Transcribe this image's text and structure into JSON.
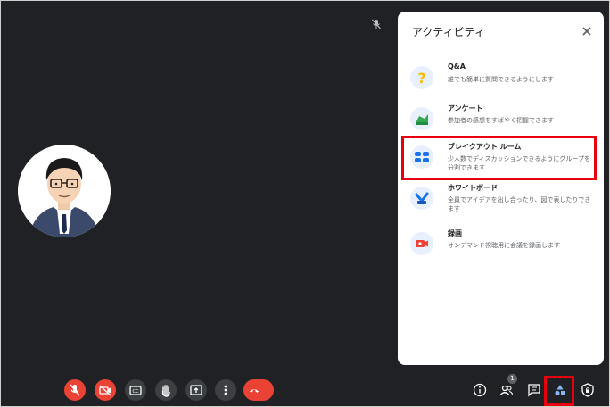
{
  "activities_panel": {
    "title": "アクティビティ",
    "close_icon": "close-icon",
    "items": [
      {
        "name": "Q&A",
        "description": "誰でも簡単に質問できるようにします",
        "icon": "question-icon"
      },
      {
        "name": "アンケート",
        "description": "参加者の感想をすばやく把握できます",
        "icon": "poll-icon"
      },
      {
        "name": "ブレイクアウト ルーム",
        "description": "少人数でディスカッションできるようにグループを分割できます",
        "icon": "breakout-rooms-icon",
        "highlighted": true
      },
      {
        "name": "ホワイトボード",
        "description": "全員でアイデアを出し合ったり、図で表したりできます",
        "icon": "whiteboard-icon"
      },
      {
        "name": "録画",
        "description": "オンデマンド視聴用に会議を録画します",
        "icon": "record-icon"
      }
    ]
  },
  "participant_avatar": {
    "icon": "user-avatar"
  },
  "mic_indicator_icon": "mic-off-icon",
  "controls": {
    "left": [
      "mic-off-icon",
      "camera-off-icon",
      "captions-icon",
      "raise-hand-icon",
      "present-screen-icon",
      "more-options-icon",
      "end-call-icon"
    ],
    "right": [
      "info-icon",
      "people-icon",
      "chat-icon",
      "activities-icon",
      "host-controls-icon"
    ],
    "people_count": "1",
    "highlighted": "activities-icon"
  },
  "colors": {
    "background": "#202124",
    "danger": "#ea4335",
    "highlight": "#e8000f",
    "accent": "#1a73e8"
  }
}
